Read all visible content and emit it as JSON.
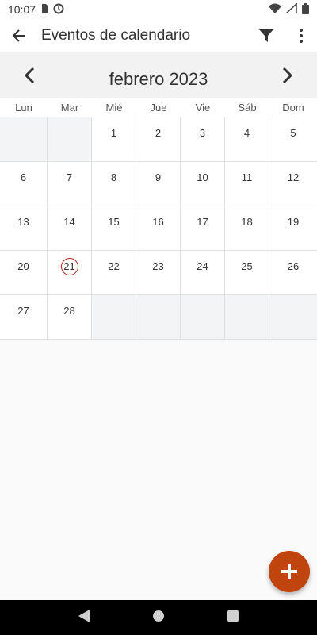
{
  "status_bar": {
    "time": "10:07",
    "icons": [
      "sim-card-icon",
      "sync-icon",
      "wifi-icon",
      "battery-icon",
      "signal-icon"
    ]
  },
  "app_bar": {
    "title": "Eventos de calendario",
    "icons": [
      "back-arrow-icon",
      "filter-icon",
      "more-vert-icon"
    ]
  },
  "calendar": {
    "month_title": "febrero 2023",
    "weekdays": [
      "Lun",
      "Mar",
      "Mié",
      "Jue",
      "Vie",
      "Sáb",
      "Dom"
    ],
    "days": [
      "",
      "",
      "1",
      "2",
      "3",
      "4",
      "5",
      "6",
      "7",
      "8",
      "9",
      "10",
      "11",
      "12",
      "13",
      "14",
      "15",
      "16",
      "17",
      "18",
      "19",
      "20",
      "21",
      "22",
      "23",
      "24",
      "25",
      "26",
      "27",
      "28",
      "",
      "",
      "",
      "",
      ""
    ],
    "today": "21"
  },
  "colors": {
    "accent": "#c0440e",
    "today_ring": "#b71c1c",
    "empty_cell": "#f3f4f6"
  },
  "fab": {
    "icon": "plus-icon"
  },
  "nav_bar": {
    "icons": [
      "back-triangle-icon",
      "home-circle-icon",
      "recents-square-icon"
    ]
  }
}
